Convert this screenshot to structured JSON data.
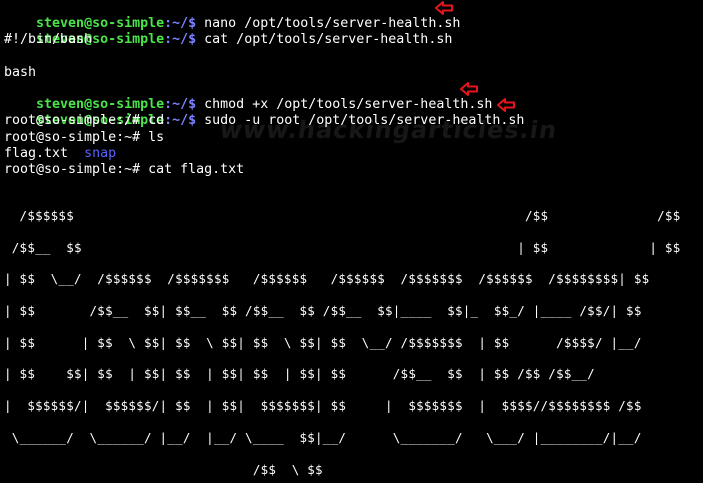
{
  "terminal": {
    "lines": [
      {
        "user": "steven@so-simple",
        "path": ":~/$ ",
        "cmd": "nano /opt/tools/server-health.sh",
        "arrow": true
      },
      {
        "user": "steven@so-simple",
        "path": ":~/$ ",
        "cmd": "cat /opt/tools/server-health.sh",
        "arrow": false
      },
      {
        "plain": "#!/bin/bash"
      },
      {
        "plain": ""
      },
      {
        "plain": "bash"
      },
      {
        "user": "steven@so-simple",
        "path": ":~/$ ",
        "cmd": "chmod +x /opt/tools/server-health.sh",
        "arrow": true
      },
      {
        "user": "steven@so-simple",
        "path": ":~/$ ",
        "cmd": "sudo -u root /opt/tools/server-health.sh",
        "arrow": true
      },
      {
        "plain": "root@so-simple:/# cd"
      },
      {
        "plain": "root@so-simple:~# ls"
      },
      {
        "file": "flag.txt",
        "dir": "snap"
      },
      {
        "plain": "root@so-simple:~# cat flag.txt"
      }
    ]
  },
  "line1": {
    "user": "steven@so-simple",
    "path": ":~/$",
    "cmd": " nano /opt/tools/server-health.sh"
  },
  "line2": {
    "user": "steven@so-simple",
    "path": ":~/$",
    "cmd": " cat /opt/tools/server-health.sh"
  },
  "line3": {
    "text": "#!/bin/bash"
  },
  "line5": {
    "text": "bash"
  },
  "line6": {
    "user": "steven@so-simple",
    "path": ":~/$",
    "cmd": " chmod +x /opt/tools/server-health.sh"
  },
  "line7": {
    "user": "steven@so-simple",
    "path": ":~/$",
    "cmd": " sudo -u root /opt/tools/server-health.sh"
  },
  "line8": {
    "text": "root@so-simple:/# cd"
  },
  "line9": {
    "text": "root@so-simple:~# ls"
  },
  "line10": {
    "file": "flag.txt",
    "dir": "snap"
  },
  "line11": {
    "text": "root@so-simple:~# cat flag.txt"
  },
  "watermark": {
    "text": "www.hackingarticles.in"
  },
  "banner": {
    "l1": "  /$$$$$$                                                          /$$              /$$",
    "l2": " /$$__  $$                                                        | $$             | $$",
    "l3": "| $$  \\__/  /$$$$$$  /$$$$$$$   /$$$$$$   /$$$$$$  /$$$$$$$  /$$$$$$  /$$$$$$$$| $$",
    "l4": "| $$       /$$__  $$| $$__  $$ /$$__  $$ /$$__  $$|____  $$|_  $$_/ |____ /$$/| $$",
    "l5": "| $$      | $$  \\ $$| $$  \\ $$| $$  \\ $$| $$  \\__/ /$$$$$$$  | $$      /$$$$/ |__/",
    "l6": "| $$    $$| $$  | $$| $$  | $$| $$  | $$| $$      /$$__  $$  | $$ /$$ /$$__/",
    "l7": "|  $$$$$$/|  $$$$$$/| $$  | $$|  $$$$$$$| $$     |  $$$$$$$  |  $$$$//$$$$$$$$ /$$",
    "l8": " \\______/  \\______/ |__/  |__/ \\____  $$|__/      \\_______/   \\___/ |________/|__/",
    "l9": "                                /$$  \\ $$"
  },
  "colors": {
    "background": "#000000",
    "user_prompt": "#4ae34a",
    "path_prompt": "#7b84ff",
    "directory": "#5a62ff",
    "arrow": "#e8141b"
  }
}
